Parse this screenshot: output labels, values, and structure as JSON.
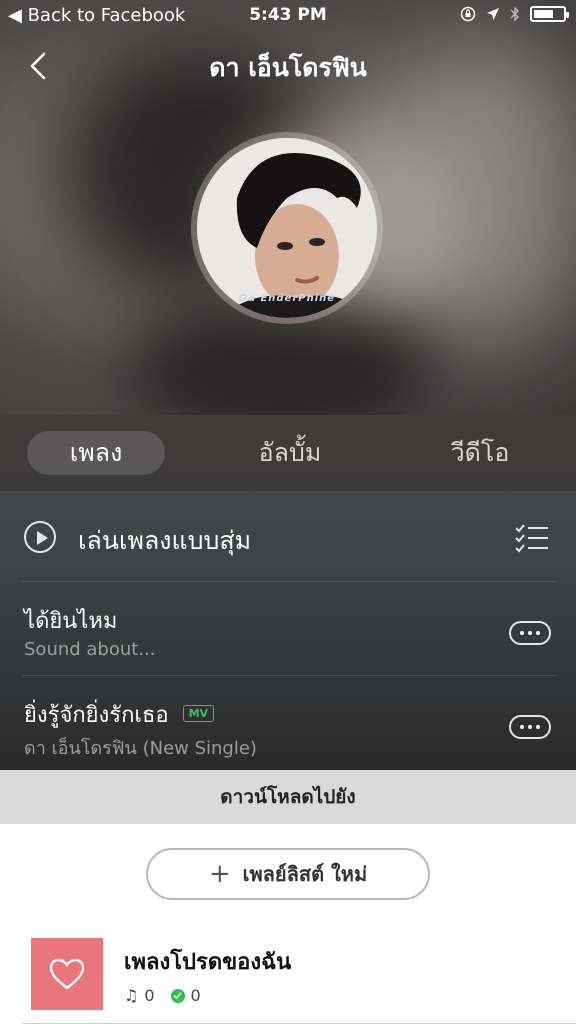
{
  "status_bar": {
    "back_label": "◀ Back to Facebook",
    "time": "5:43 PM"
  },
  "header": {
    "title": "ดา เอ็นโดรฟิน"
  },
  "artist": {
    "avatar_caption": "Da EnderPhine"
  },
  "tabs": [
    {
      "label": "เพลง",
      "active": true
    },
    {
      "label": "อัลบั้ม",
      "active": false
    },
    {
      "label": "วีดีโอ",
      "active": false
    }
  ],
  "shuffle": {
    "label": "เล่นเพลงแบบสุ่ม"
  },
  "songs": [
    {
      "title": "ได้ยินไหม",
      "subtitle": "Sound about...",
      "mv": ""
    },
    {
      "title": "ยิ่งรู้จักยิ่งรักเธอ",
      "subtitle": "ดา เอ็นโดรฟิน (New Single)",
      "mv": "MV"
    }
  ],
  "download_sheet": {
    "header": "ดาวน์โหลดไปยัง",
    "new_playlist_label": "เพลย์ลิสต์ ใหม่",
    "playlists": [
      {
        "title": "เพลงโปรดของฉัน",
        "song_count": "0",
        "downloaded_count": "0"
      }
    ]
  },
  "colors": {
    "accent_green": "#2bbf4c",
    "favorite_thumb": "#e8767a"
  }
}
